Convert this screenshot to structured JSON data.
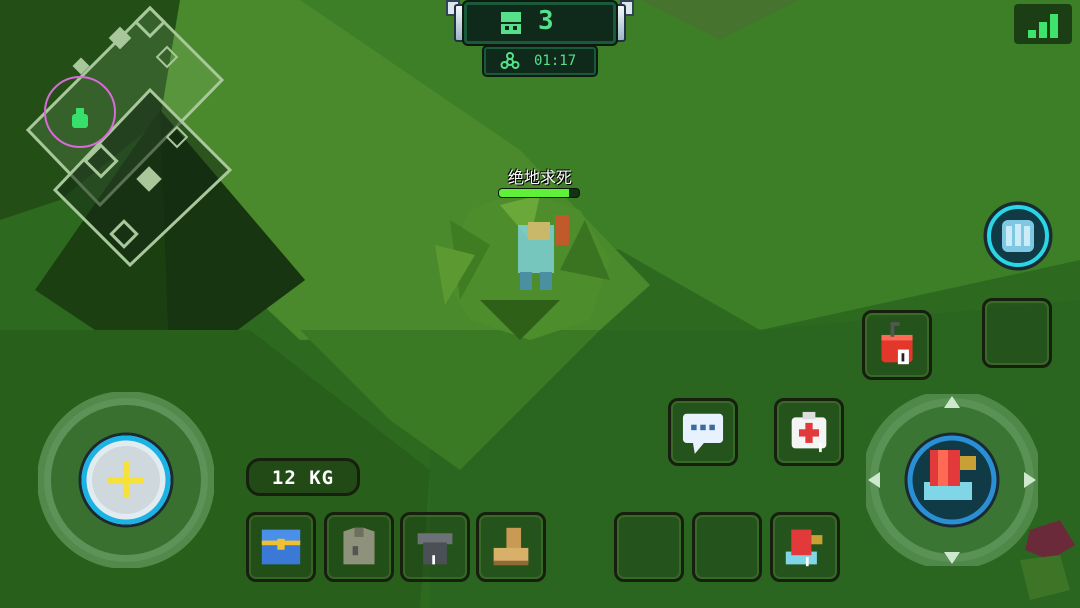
{
  "hud": {
    "alive_count": "3",
    "match_timer": "01:17",
    "weight": "12 KG",
    "player_name": "绝地求死",
    "player_health": 0.88
  },
  "colors": {
    "hud_green": "#57e08a",
    "signal_green": "#3fe36b",
    "health_green": "#5ff03a",
    "joystick_ring": "#1bb3e6",
    "zone_circle": "#d96ad9"
  },
  "icons": {
    "alive": "player-face-icon",
    "timer": "biohazard-icon",
    "signal": "signal-strength-icon",
    "sprint": "footprint-icon",
    "dynamite": "dynamite-icon",
    "chat": "chat-bubble-icon",
    "medkit": "medkit-icon",
    "fire": "blaster-gun-icon",
    "joystick": "plus-icon",
    "backpack_slots": [
      "treasure-chest-icon",
      "vest-icon",
      "helmet-icon",
      "boot-icon"
    ],
    "weapon_slots": [
      "empty",
      "empty",
      "blaster-gun-icon"
    ]
  }
}
